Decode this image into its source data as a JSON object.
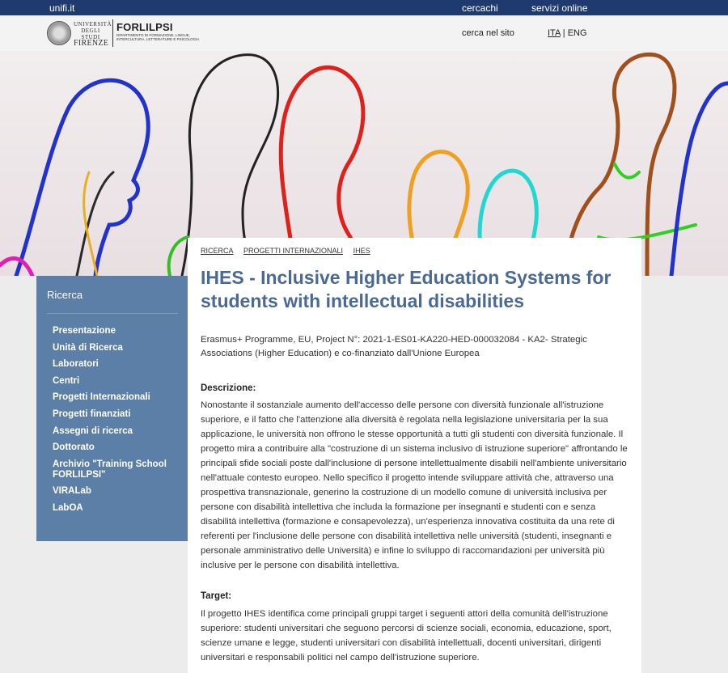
{
  "topbar": {
    "brand": "unifi.it",
    "search_people": "cercachi",
    "online_services": "servizi online"
  },
  "header": {
    "logo_uni_line1": "UNIVERSITÀ",
    "logo_uni_line2": "DEGLI STUDI",
    "logo_uni_line3": "FIRENZE",
    "logo_dept_name": "FORLILPSI",
    "logo_dept_sub": "DIPARTIMENTO DI FORMAZIONE, LINGUE, INTERCULTURA, LETTERATURE E PSICOLOGIA",
    "site_search": "cerca nel sito",
    "lang_ita": "ITA",
    "lang_sep": " | ",
    "lang_eng": "ENG"
  },
  "breadcrumb": [
    "RICERCA",
    "PROGETTI INTERNAZIONALI",
    "IHES"
  ],
  "sidebar": {
    "title": "Ricerca",
    "items": [
      "Presentazione",
      "Unità di Ricerca",
      "Laboratori",
      "Centri",
      "Progetti Internazionali",
      "Progetti finanziati",
      "Assegni di ricerca",
      "Dottorato",
      "Archivio \"Training School FORLILPSI\"",
      "VIRALab",
      "LabOA"
    ]
  },
  "main": {
    "title": "IHES - Inclusive Higher Education Systems for students with intellectual disabilities",
    "subtitle": "Erasmus+ Programme, EU, Project N°: 2021-1-ES01-KA220-HED-000032084 - KA2- Strategic Associations (Higher Education) e co-finanziato dall'Unione Europea",
    "description_heading": "Descrizione:",
    "description": "Nonostante il sostanziale aumento dell'accesso delle persone con diversità funzionale all'istruzione superiore, e il fatto che l'attenzione alla diversità è regolata nella legislazione universitaria per la sua applicazione, le università non offrono le stesse opportunità a tutti gli studenti con diversità funzionale. Il progetto mira a contribuire alla \"costruzione di un sistema inclusivo di istruzione superiore\" affrontando le principali sfide sociali poste dall'inclusione di persone intellettualmente disabili nell'ambiente universitario nell'attuale contesto europeo. Nello specifico il progetto intende sviluppare attività che, attraverso una prospettiva transnazionale, generino la costruzione di un modello comune di università inclusiva per persone con disabilità intellettiva che includa la formazione per insegnanti e studenti con e senza disabilità intellettiva (formazione e consapevolezza), un'esperienza innovativa costituita da una rete di referenti per l'inclusione delle persone con disabilità intellettiva nelle università (studenti, insegnanti e personale amministrativo delle Università) e infine lo sviluppo di raccomandazioni per università più inclusive per le persone con disabilità intellettiva.",
    "target_heading": "Target:",
    "target": "Il progetto IHES identifica come principali gruppi target i seguenti attori della comunità dell'istruzione superiore: studenti universitari che seguono percorsi di scienze sociali, economia, educazione, sport, scienze umane e legge, studenti universitari con disabilità intellettuali, docenti universitari, dirigenti universitari e responsabili politici nel campo dell'istruzione superiore."
  },
  "colors": {
    "topbar": "#1f3a6e",
    "sidebar": "#5b7fa6",
    "title": "#4a6a95"
  }
}
